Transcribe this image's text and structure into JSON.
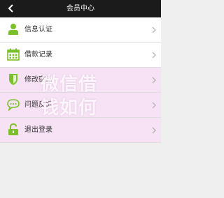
{
  "header": {
    "title": "会员中心",
    "back_icon": "chevron-left-icon",
    "background": "#1b1b1b"
  },
  "menu": {
    "items": [
      {
        "label": "信息认证",
        "icon": "user-icon",
        "icon_color": "#7ac02a"
      },
      {
        "label": "借款记录",
        "icon": "calendar-icon",
        "icon_color": "#7ac02a"
      },
      {
        "label": "修改密码",
        "icon": "shield-icon",
        "icon_color": "#7ac02a"
      },
      {
        "label": "问题反馈",
        "icon": "chat-bubble-icon",
        "icon_color": "#7ac02a"
      },
      {
        "label": "退出登录",
        "icon": "unlock-icon",
        "icon_color": "#7ac02a"
      }
    ],
    "chevron_icon": "chevron-right-icon"
  },
  "watermark": {
    "line1": "微信借",
    "line2": "钱如何"
  }
}
